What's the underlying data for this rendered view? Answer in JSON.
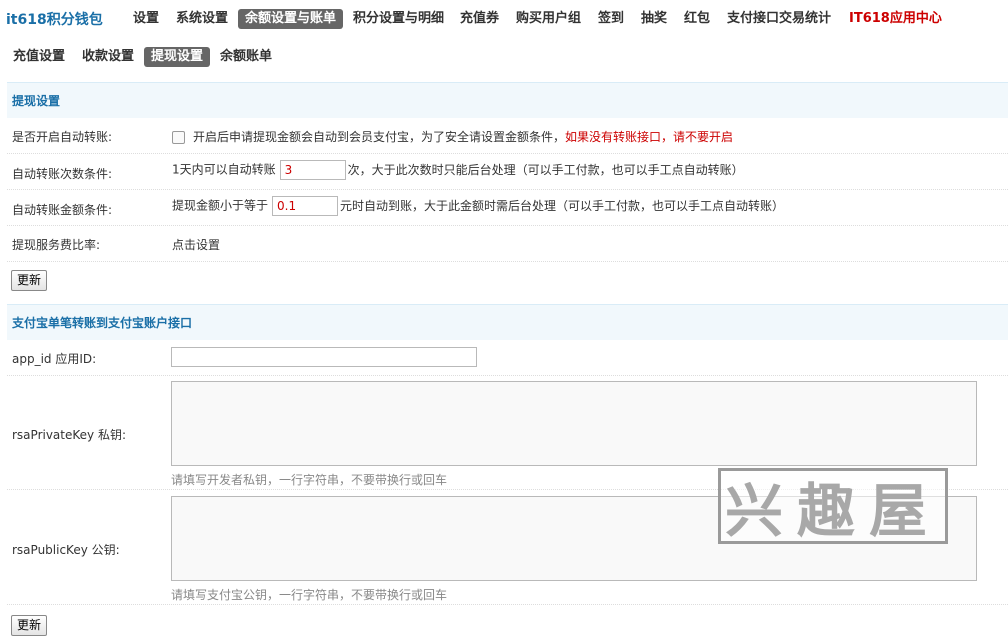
{
  "brand": "it618积分钱包",
  "topnav": [
    "设置",
    "系统设置",
    "余额设置与账单",
    "积分设置与明细",
    "充值券",
    "购买用户组",
    "签到",
    "抽奖",
    "红包",
    "支付接口交易统计",
    "IT618应用中心"
  ],
  "subnav": [
    "充值设置",
    "收款设置",
    "提现设置",
    "余额账单"
  ],
  "withdraw": {
    "title": "提现设置",
    "auto_transfer": {
      "label": "是否开启自动转账:",
      "desc": "开启后申请提现金额会自动到会员支付宝，为了安全请设置金额条件，",
      "warn": "如果没有转账接口，请不要开启"
    },
    "count": {
      "label": "自动转账次数条件:",
      "prefix": "1天内可以自动转账",
      "value": "3",
      "suffix": "次，大于此次数时只能后台处理（可以手工付款，也可以手工点自动转账）"
    },
    "amount": {
      "label": "自动转账金额条件:",
      "prefix": "提现金额小于等于",
      "value": "0.1",
      "suffix": "元时自动到账，大于此金额时需后台处理（可以手工付款，也可以手工点自动转账）"
    },
    "fee": {
      "label": "提现服务费比率:",
      "link": "点击设置"
    },
    "submit": "更新"
  },
  "alipay": {
    "title": "支付宝单笔转账到支付宝账户接口",
    "app_id_label": "app_id 应用ID:",
    "private_label": "rsaPrivateKey 私钥:",
    "private_hint": "请填写开发者私钥，一行字符串，不要带换行或回车",
    "public_label": "rsaPublicKey 公钥:",
    "public_hint": "请填写支付宝公钥，一行字符串，不要带换行或回车",
    "submit": "更新"
  },
  "watermark": "兴趣屋"
}
